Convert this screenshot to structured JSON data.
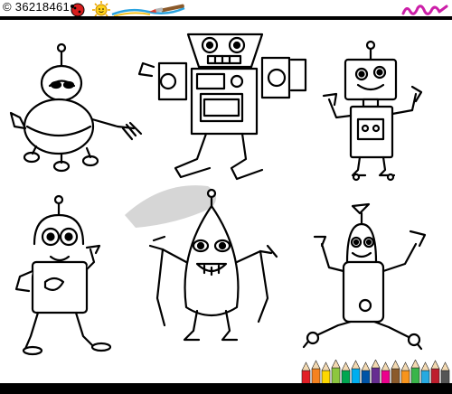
{
  "header": {
    "image_id": "© 36218461"
  },
  "colors": {
    "bar": "#000000",
    "background": "#ffffff",
    "accent_magenta": "#cc1fa8"
  },
  "icons": [
    "ladybug-icon",
    "sun-icon",
    "paintbrush-icon",
    "squiggle-icon",
    "colored-pencils-icon"
  ],
  "illustration": {
    "subjects": [
      "robot-1",
      "robot-2",
      "robot-3",
      "robot-4",
      "robot-5",
      "robot-6"
    ]
  }
}
